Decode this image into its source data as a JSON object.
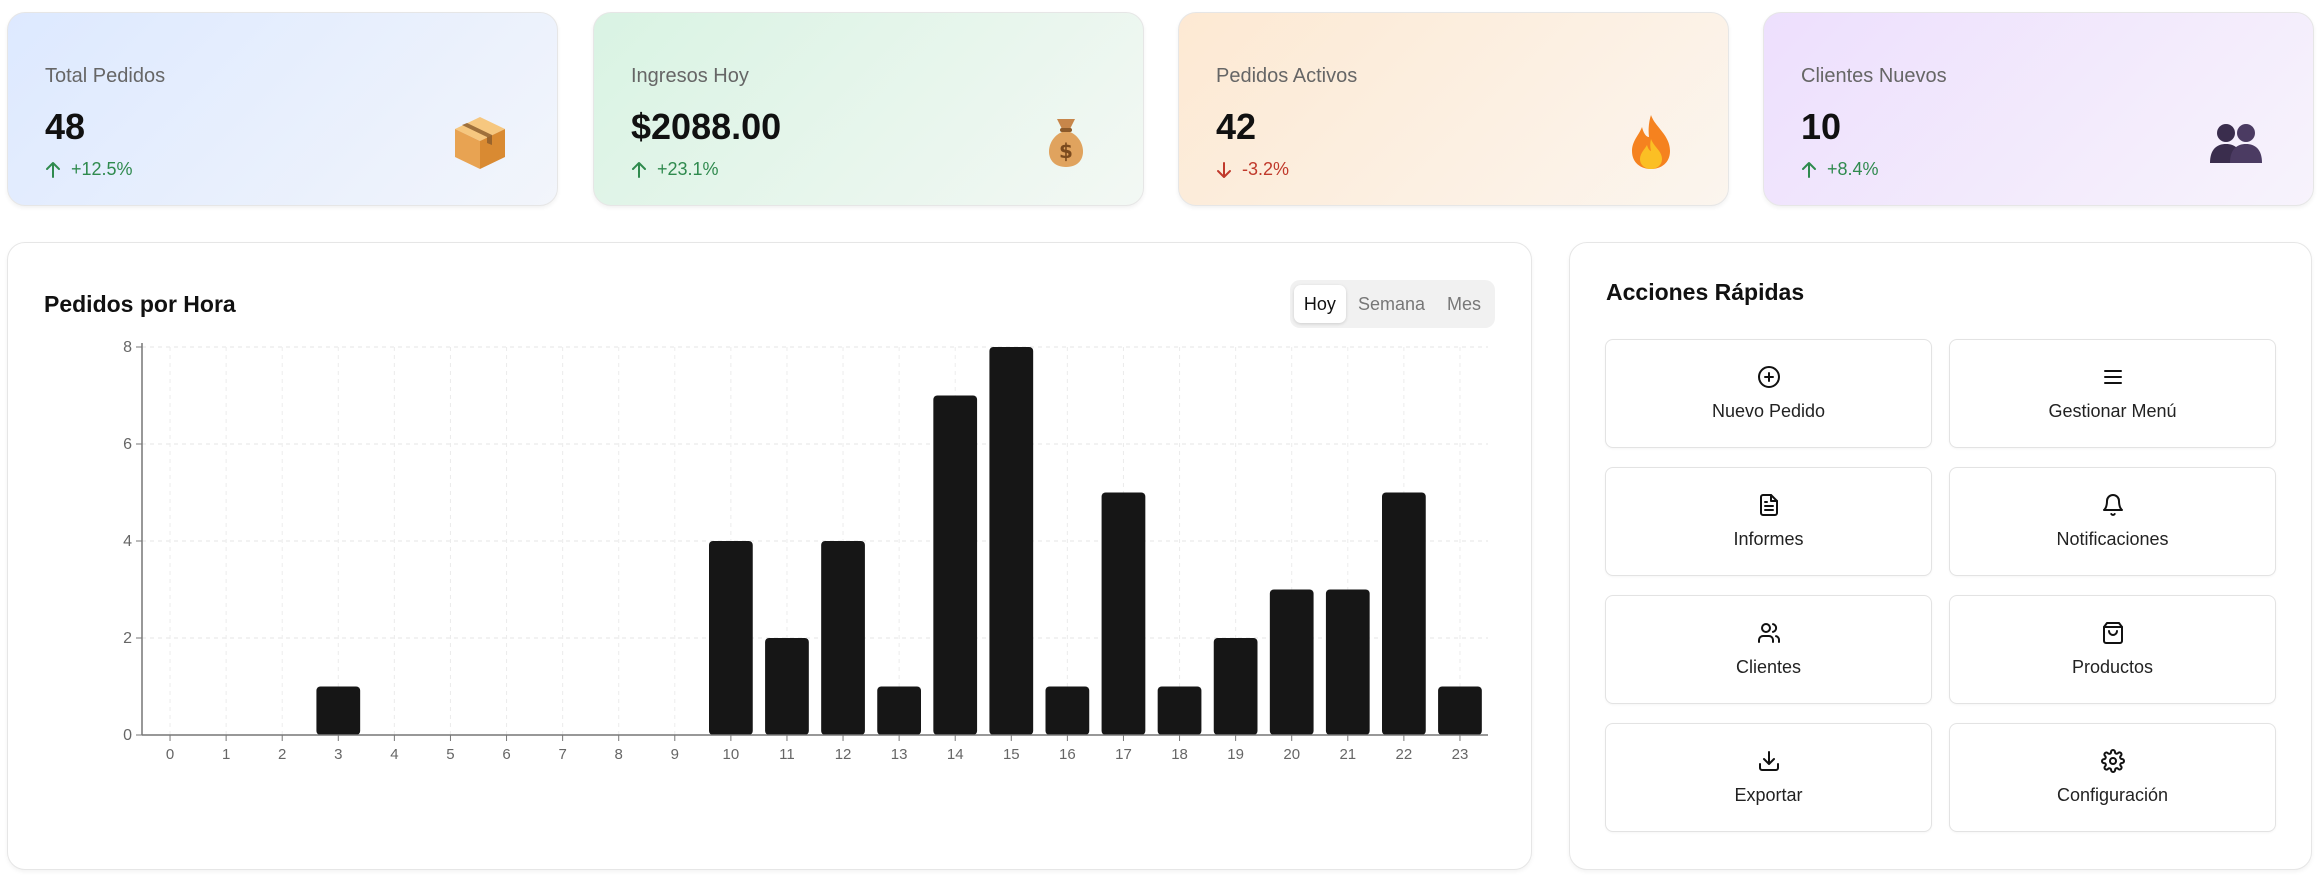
{
  "stats": [
    {
      "label": "Total Pedidos",
      "value": "48",
      "delta": "+12.5%",
      "trend": "up",
      "icon": "package-icon"
    },
    {
      "label": "Ingresos Hoy",
      "value": "$2088.00",
      "delta": "+23.1%",
      "trend": "up",
      "icon": "money-bag-icon"
    },
    {
      "label": "Pedidos Activos",
      "value": "42",
      "delta": "-3.2%",
      "trend": "down",
      "icon": "fire-icon"
    },
    {
      "label": "Clientes Nuevos",
      "value": "10",
      "delta": "+8.4%",
      "trend": "up",
      "icon": "users-icon"
    }
  ],
  "chart_panel": {
    "title": "Pedidos por Hora",
    "range_tabs": [
      "Hoy",
      "Semana",
      "Mes"
    ],
    "active_tab": "Hoy"
  },
  "chart_data": {
    "type": "bar",
    "categories": [
      "0",
      "1",
      "2",
      "3",
      "4",
      "5",
      "6",
      "7",
      "8",
      "9",
      "10",
      "11",
      "12",
      "13",
      "14",
      "15",
      "16",
      "17",
      "18",
      "19",
      "20",
      "21",
      "22",
      "23"
    ],
    "values": [
      0,
      0,
      0,
      1,
      0,
      0,
      0,
      0,
      0,
      0,
      4,
      2,
      4,
      1,
      7,
      8,
      1,
      5,
      1,
      2,
      3,
      3,
      5,
      1
    ],
    "ylim": [
      0,
      8
    ],
    "yticks": [
      "0",
      "2",
      "4",
      "6",
      "8"
    ],
    "grid": true,
    "bar_color": "#161616"
  },
  "quick_actions": {
    "title": "Acciones Rápidas",
    "items": [
      {
        "label": "Nuevo Pedido",
        "icon": "plus-circle-icon"
      },
      {
        "label": "Gestionar Menú",
        "icon": "menu-icon"
      },
      {
        "label": "Informes",
        "icon": "file-text-icon"
      },
      {
        "label": "Notificaciones",
        "icon": "bell-icon"
      },
      {
        "label": "Clientes",
        "icon": "users-outline-icon"
      },
      {
        "label": "Productos",
        "icon": "shopping-bag-icon"
      },
      {
        "label": "Exportar",
        "icon": "download-icon"
      },
      {
        "label": "Configuración",
        "icon": "settings-icon"
      }
    ]
  }
}
